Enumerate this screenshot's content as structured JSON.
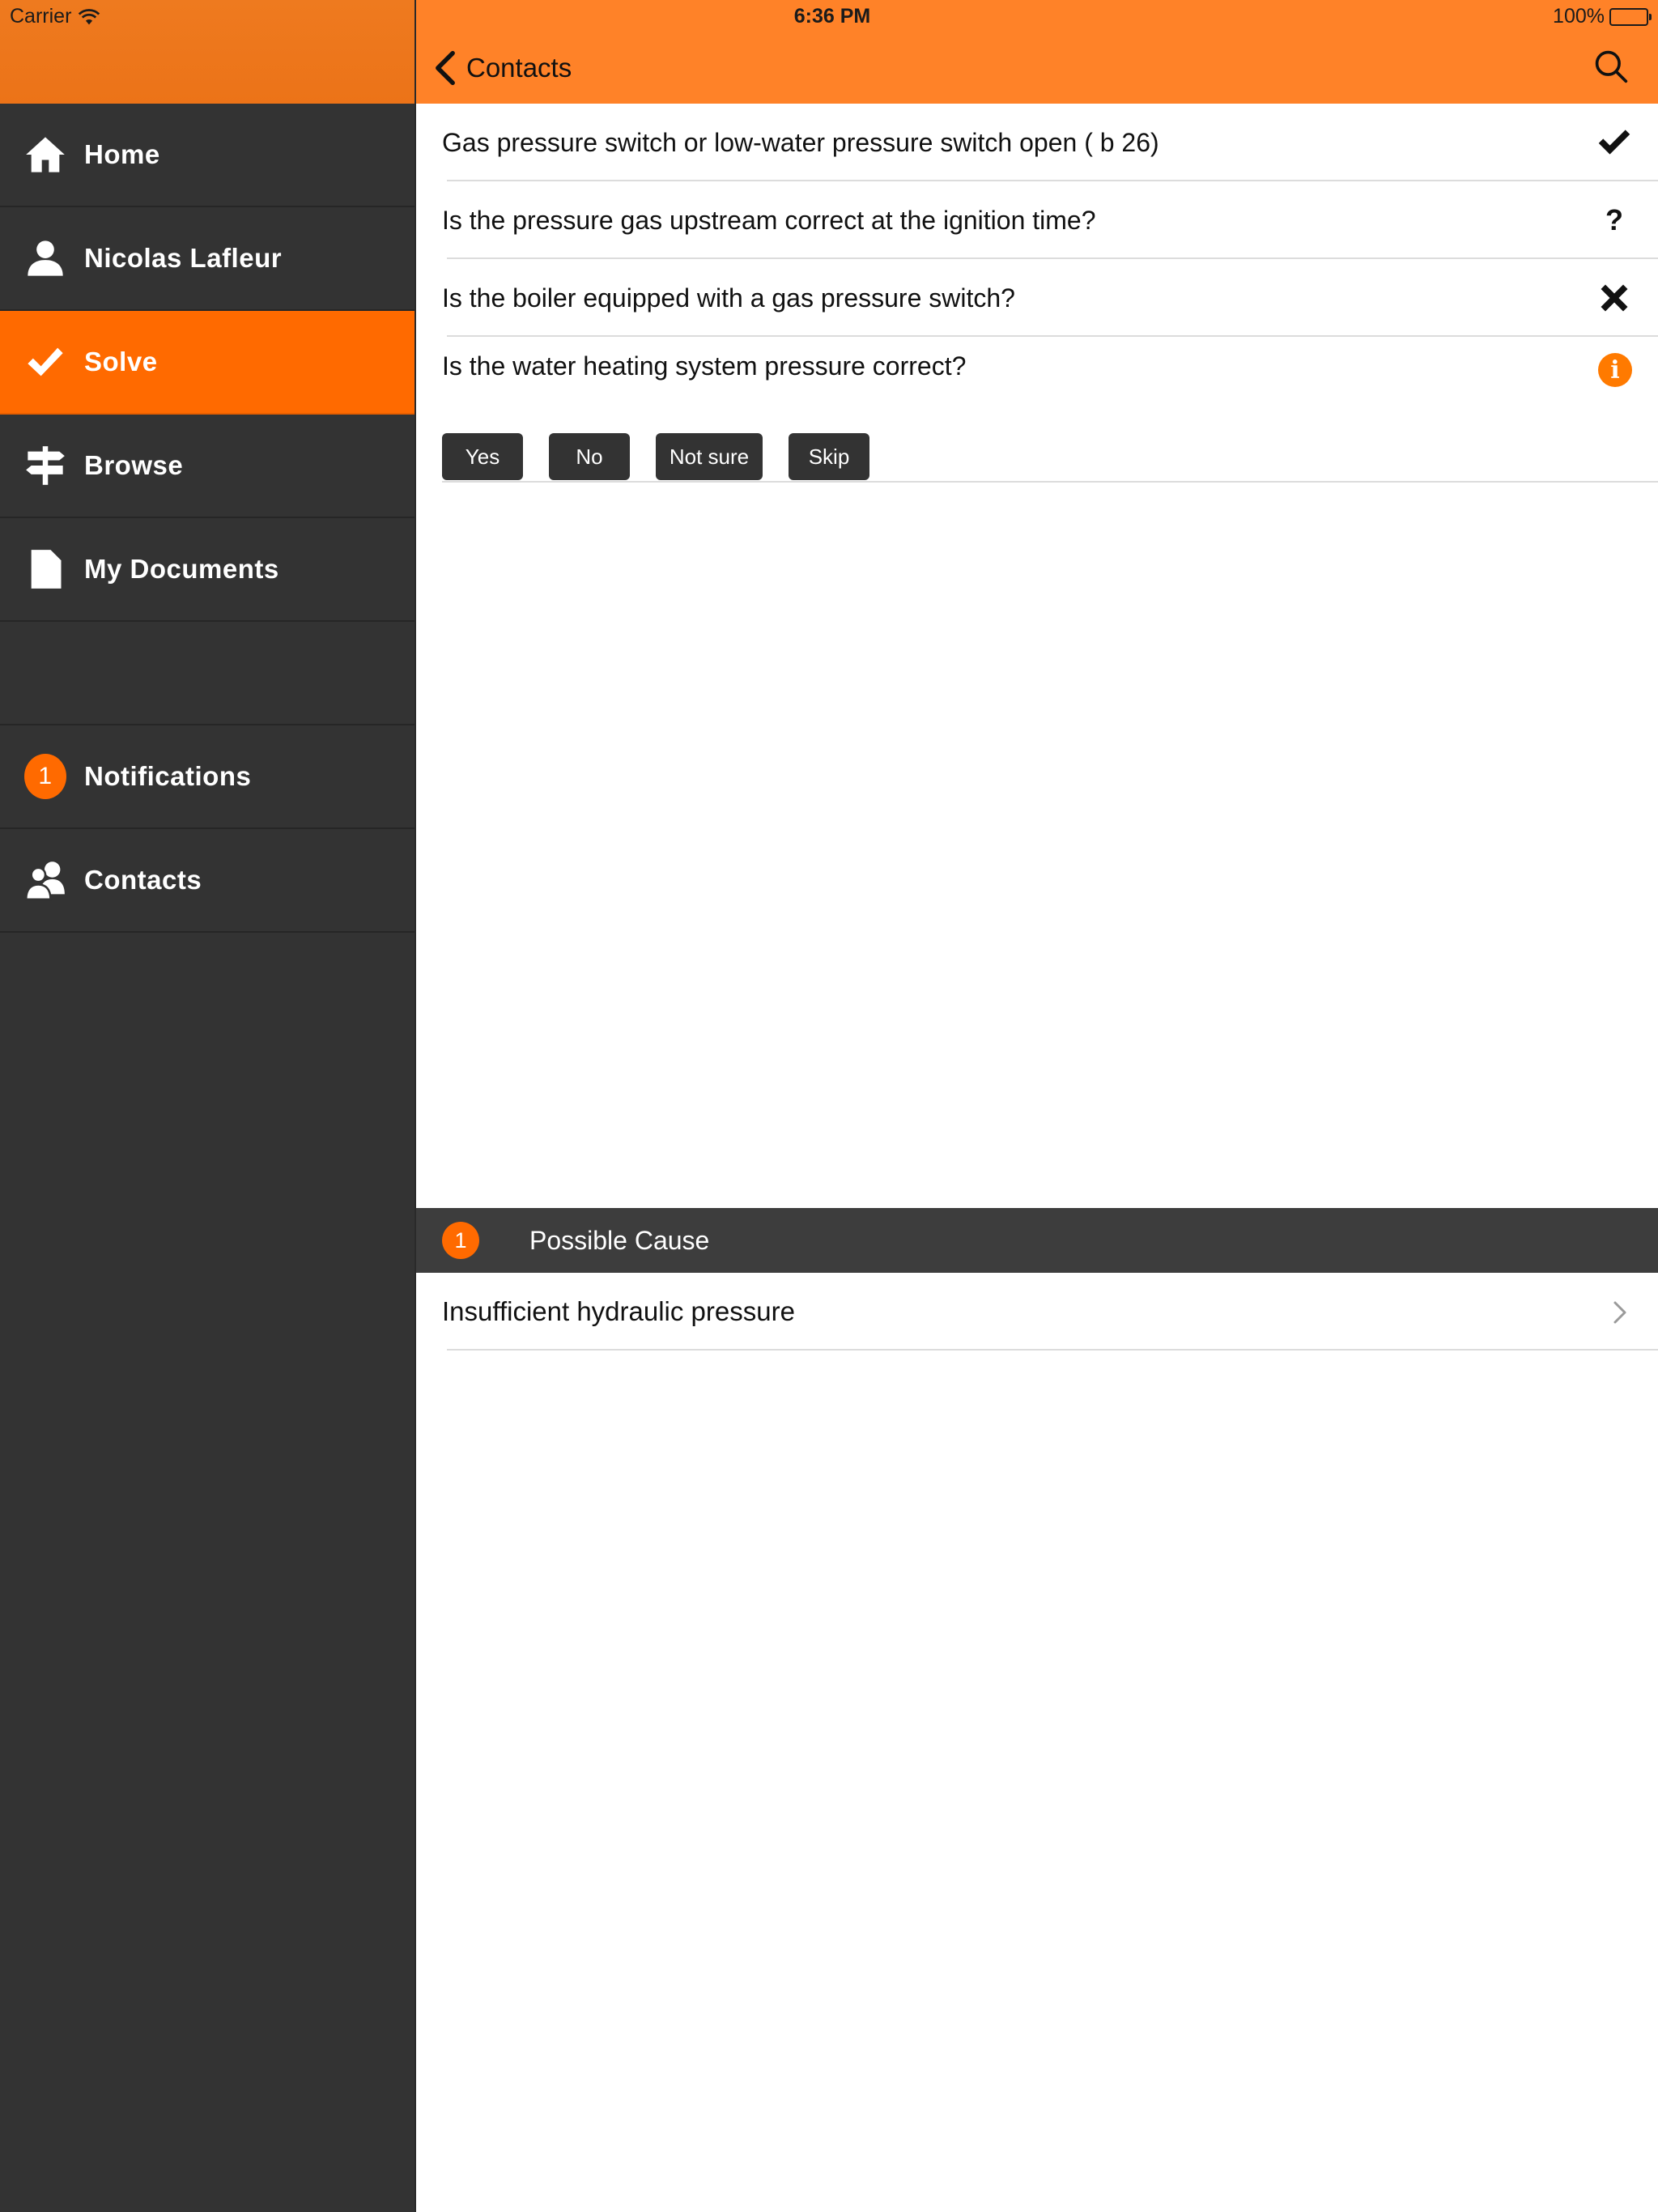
{
  "status_bar": {
    "carrier": "Carrier",
    "time": "6:36 PM",
    "battery": "100%"
  },
  "sidebar": {
    "items": [
      {
        "label": "Home",
        "icon": "home-icon"
      },
      {
        "label": "Nicolas Lafleur",
        "icon": "user-icon"
      },
      {
        "label": "Solve",
        "icon": "check-icon",
        "active": true
      },
      {
        "label": "Browse",
        "icon": "signpost-icon"
      },
      {
        "label": "My Documents",
        "icon": "document-icon"
      }
    ],
    "secondary": [
      {
        "label": "Notifications",
        "badge": "1"
      },
      {
        "label": "Contacts",
        "icon": "contacts-icon"
      }
    ]
  },
  "navbar": {
    "back_label": "Contacts",
    "search_icon": "search-icon"
  },
  "questions": [
    {
      "text": "Gas pressure switch or low-water pressure switch open ( b 26)",
      "status": "yes",
      "status_icon": "checkmark-icon"
    },
    {
      "text": "Is the pressure gas upstream correct at the ignition time?",
      "status": "not-sure",
      "status_icon": "question-mark-icon",
      "glyph": "?"
    },
    {
      "text": "Is the boiler equipped with a gas pressure switch?",
      "status": "no",
      "status_icon": "cross-icon"
    }
  ],
  "current_question": {
    "text": "Is the water heating system pressure correct?",
    "status_icon": "info-icon",
    "info_glyph": "i",
    "answers": [
      "Yes",
      "No",
      "Not sure",
      "Skip"
    ]
  },
  "possible_cause": {
    "count": "1",
    "title": "Possible Cause",
    "items": [
      "Insufficient hydraulic pressure"
    ]
  },
  "colors": {
    "accent": "#ff6a00",
    "navbar": "#ff8228",
    "sidebar_bg": "#333333"
  }
}
